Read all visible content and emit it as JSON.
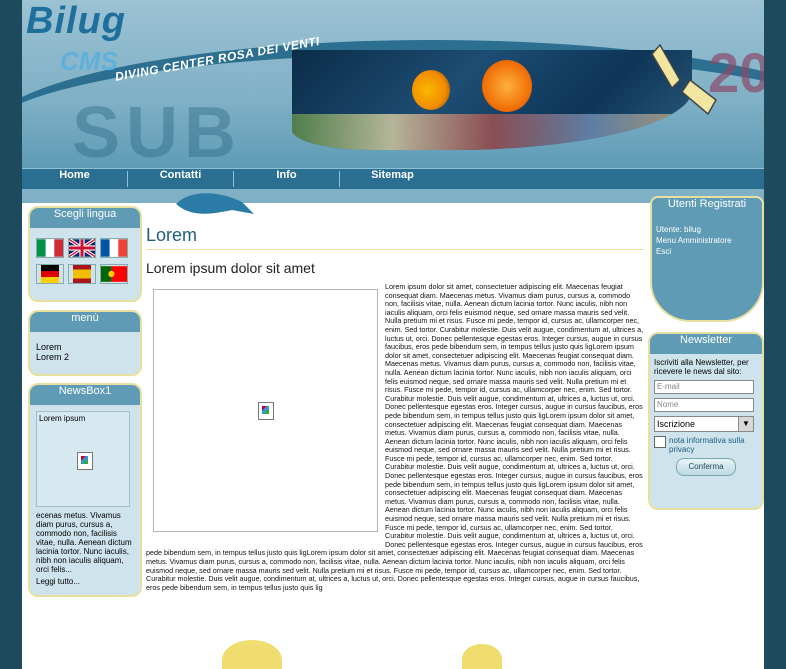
{
  "header": {
    "logo_title": "Bilug",
    "logo_sub": "CMS",
    "tagline": "DIVING CENTER ROSA DEI VENTI",
    "watermark_left": "SUB",
    "watermark_right": "20"
  },
  "nav": {
    "items": [
      "Home",
      "Contatti",
      "Info",
      "Sitemap"
    ]
  },
  "left": {
    "language_box": {
      "title": "Scegli lingua",
      "flags": [
        "italy-flag-icon",
        "uk-flag-icon",
        "france-flag-icon",
        "germany-flag-icon",
        "spain-flag-icon",
        "portugal-flag-icon"
      ]
    },
    "menu_box": {
      "title": "menù",
      "links": [
        "Lorem",
        "Lorem 2"
      ]
    },
    "news_box": {
      "title": "NewsBox1",
      "image_caption": "Lorem ipsum",
      "text": "ecenas metus. Vivamus diam purus, cursus a, commodo non, facilisis vitae, nulla. Aenean dictum lacinia tortor. Nunc iaculis, nibh non iaculis aliquam, orci felis...",
      "more": "Leggi tutto..."
    }
  },
  "main": {
    "title": "Lorem",
    "subtitle": "Lorem ipsum dolor sit amet",
    "body": "Lorem ipsum dolor sit amet, consectetuer adipiscing elit. Maecenas feugiat consequat diam. Maecenas metus. Vivamus diam purus, cursus a, commodo non, facilisis vitae, nulla. Aenean dictum lacinia tortor. Nunc iaculis, nibh non iaculis aliquam, orci felis euismod neque, sed ornare massa mauris sed velit. Nulla pretium mi et risus. Fusce mi pede, tempor id, cursus ac, ullamcorper nec, enim. Sed tortor. Curabitur molestie. Duis velit augue, condimentum at, ultrices a, luctus ut, orci. Donec pellentesque egestas eros. Integer cursus, augue in cursus faucibus, eros pede bibendum sem, in tempus tellus justo quis ligLorem ipsum dolor sit amet, consectetuer adipiscing elit. Maecenas feugiat consequat diam. Maecenas metus. Vivamus diam purus, cursus a, commodo non, facilisis vitae, nulla. Aenean dictum lacinia tortor. Nunc iaculis, nibh non iaculis aliquam, orci felis euismod neque, sed ornare massa mauris sed velit. Nulla pretium mi et risus. Fusce mi pede, tempor id, cursus ac, ullamcorper nec, enim. Sed tortor. Curabitur molestie. Duis velit augue, condimentum at, ultrices a, luctus ut, orci. Donec pellentesque egestas eros. Integer cursus, augue in cursus faucibus, eros pede bibendum sem, in tempus tellus justo quis ligLorem ipsum dolor sit amet, consectetuer adipiscing elit. Maecenas feugiat consequat diam. Maecenas metus. Vivamus diam purus, cursus a, commodo non, facilisis vitae, nulla. Aenean dictum lacinia tortor. Nunc iaculis, nibh non iaculis aliquam, orci felis euismod neque, sed ornare massa mauris sed velit. Nulla pretium mi et risus. Fusce mi pede, tempor id, cursus ac, ullamcorper nec, enim. Sed tortor. Curabitur molestie. Duis velit augue, condimentum at, ultrices a, luctus ut, orci. Donec pellentesque egestas eros. Integer cursus, augue in cursus faucibus, eros pede bibendum sem, in tempus tellus justo quis ligLorem ipsum dolor sit amet, consectetuer adipiscing elit. Maecenas feugiat consequat diam. Maecenas metus. Vivamus diam purus, cursus a, commodo non, facilisis vitae, nulla. Aenean dictum lacinia tortor. Nunc iaculis, nibh non iaculis aliquam, orci felis euismod neque, sed ornare massa mauris sed velit. Nulla pretium mi et risus. Fusce mi pede, tempor id, cursus ac, ullamcorper nec, enim. Sed tortor. Curabitur molestie. Duis velit augue, condimentum at, ultrices a, luctus ut, orci. Donec pellentesque egestas eros. Integer cursus, augue in cursus faucibus, eros pede bibendum sem, in tempus tellus justo quis ligLorem ipsum dolor sit amet, consectetuer adipiscing elit. Maecenas feugiat consequat diam. Maecenas metus. Vivamus diam purus, cursus a, commodo non, facilisis vitae, nulla. Aenean dictum lacinia tortor. Nunc iaculis, nibh non iaculis aliquam, orci felis euismod neque, sed ornare massa mauris sed velit. Nulla pretium mi et risus. Fusce mi pede, tempor id, cursus ac, ullamcorper nec, enim. Sed tortor. Curabitur molestie. Duis velit augue, condimentum at, ultrices a, luctus ut, orci. Donec pellentesque egestas eros. Integer cursus, augue in cursus faucibus, eros pede bibendum sem, in tempus tellus justo quis lig"
  },
  "right": {
    "users_box": {
      "title": "Utenti Registrati",
      "user_line": "Utente: bilug",
      "admin_link": "Menu Amministratore",
      "logout_link": "Esci"
    },
    "newsletter_box": {
      "title": "Newsletter",
      "description": "Iscriviti alla Newsletter, per ricevere le news dal sito:",
      "email_placeholder": "E-mail",
      "name_placeholder": "Nome",
      "select_value": "Iscrizione",
      "privacy_label": "nota informativa sulla privacy",
      "confirm_label": "Conferma"
    }
  },
  "colors": {
    "page_bg": "#1d4a5c",
    "nav_bg": "#2a6f92",
    "box_head": "#5f9bb5",
    "box_body": "#cfe3ec",
    "box_border": "#e8e0a0",
    "title_blue": "#1d5f80"
  }
}
